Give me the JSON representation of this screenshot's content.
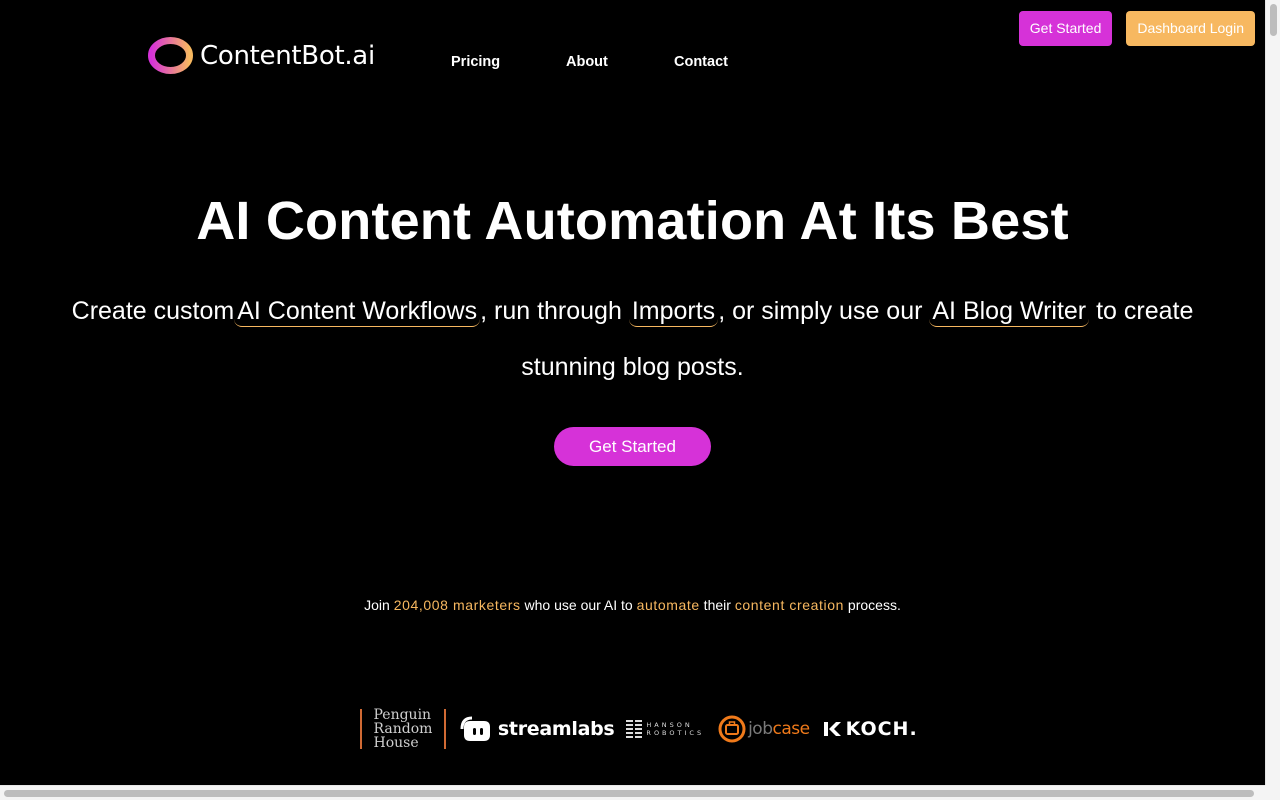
{
  "top_actions": {
    "get_started": "Get Started",
    "dashboard_login": "Dashboard Login"
  },
  "header": {
    "logo_text": "ContentBot.ai",
    "nav": [
      "Pricing",
      "About",
      "Contact"
    ]
  },
  "hero": {
    "title": "AI Content Automation At Its Best",
    "subtitle_parts": {
      "p1": "Create custom",
      "link1": "AI Content Workflows",
      "p2": ", run through ",
      "link2": "Imports",
      "p3": ", or simply use our ",
      "link3": "AI Blog Writer",
      "p4": " to create stunning blog posts."
    },
    "cta": "Get Started"
  },
  "join": {
    "w1": "Join ",
    "count": "204,008 marketers",
    "w2": " who use our AI to ",
    "a1": "automate",
    "w3": " their ",
    "a2": "content creation",
    "w4": " process."
  },
  "client_logos": {
    "penguin": [
      "Penguin",
      "Random",
      "House"
    ],
    "streamlabs": "streamlabs",
    "hanson": [
      "HANSON",
      "ROBOTICS"
    ],
    "jobcase": [
      "job",
      "case"
    ],
    "koch": "KOCH."
  },
  "colors": {
    "accent_pink": "#d632d8",
    "accent_orange": "#f7b860",
    "background": "#000000"
  }
}
